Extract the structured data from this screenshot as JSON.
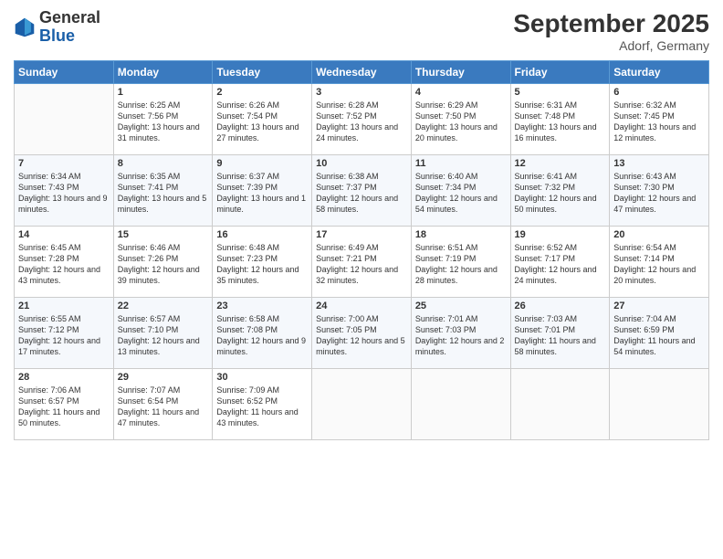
{
  "header": {
    "logo_general": "General",
    "logo_blue": "Blue",
    "month_title": "September 2025",
    "location": "Adorf, Germany"
  },
  "weekdays": [
    "Sunday",
    "Monday",
    "Tuesday",
    "Wednesday",
    "Thursday",
    "Friday",
    "Saturday"
  ],
  "weeks": [
    [
      {
        "day": "",
        "sunrise": "",
        "sunset": "",
        "daylight": ""
      },
      {
        "day": "1",
        "sunrise": "Sunrise: 6:25 AM",
        "sunset": "Sunset: 7:56 PM",
        "daylight": "Daylight: 13 hours and 31 minutes."
      },
      {
        "day": "2",
        "sunrise": "Sunrise: 6:26 AM",
        "sunset": "Sunset: 7:54 PM",
        "daylight": "Daylight: 13 hours and 27 minutes."
      },
      {
        "day": "3",
        "sunrise": "Sunrise: 6:28 AM",
        "sunset": "Sunset: 7:52 PM",
        "daylight": "Daylight: 13 hours and 24 minutes."
      },
      {
        "day": "4",
        "sunrise": "Sunrise: 6:29 AM",
        "sunset": "Sunset: 7:50 PM",
        "daylight": "Daylight: 13 hours and 20 minutes."
      },
      {
        "day": "5",
        "sunrise": "Sunrise: 6:31 AM",
        "sunset": "Sunset: 7:48 PM",
        "daylight": "Daylight: 13 hours and 16 minutes."
      },
      {
        "day": "6",
        "sunrise": "Sunrise: 6:32 AM",
        "sunset": "Sunset: 7:45 PM",
        "daylight": "Daylight: 13 hours and 12 minutes."
      }
    ],
    [
      {
        "day": "7",
        "sunrise": "Sunrise: 6:34 AM",
        "sunset": "Sunset: 7:43 PM",
        "daylight": "Daylight: 13 hours and 9 minutes."
      },
      {
        "day": "8",
        "sunrise": "Sunrise: 6:35 AM",
        "sunset": "Sunset: 7:41 PM",
        "daylight": "Daylight: 13 hours and 5 minutes."
      },
      {
        "day": "9",
        "sunrise": "Sunrise: 6:37 AM",
        "sunset": "Sunset: 7:39 PM",
        "daylight": "Daylight: 13 hours and 1 minute."
      },
      {
        "day": "10",
        "sunrise": "Sunrise: 6:38 AM",
        "sunset": "Sunset: 7:37 PM",
        "daylight": "Daylight: 12 hours and 58 minutes."
      },
      {
        "day": "11",
        "sunrise": "Sunrise: 6:40 AM",
        "sunset": "Sunset: 7:34 PM",
        "daylight": "Daylight: 12 hours and 54 minutes."
      },
      {
        "day": "12",
        "sunrise": "Sunrise: 6:41 AM",
        "sunset": "Sunset: 7:32 PM",
        "daylight": "Daylight: 12 hours and 50 minutes."
      },
      {
        "day": "13",
        "sunrise": "Sunrise: 6:43 AM",
        "sunset": "Sunset: 7:30 PM",
        "daylight": "Daylight: 12 hours and 47 minutes."
      }
    ],
    [
      {
        "day": "14",
        "sunrise": "Sunrise: 6:45 AM",
        "sunset": "Sunset: 7:28 PM",
        "daylight": "Daylight: 12 hours and 43 minutes."
      },
      {
        "day": "15",
        "sunrise": "Sunrise: 6:46 AM",
        "sunset": "Sunset: 7:26 PM",
        "daylight": "Daylight: 12 hours and 39 minutes."
      },
      {
        "day": "16",
        "sunrise": "Sunrise: 6:48 AM",
        "sunset": "Sunset: 7:23 PM",
        "daylight": "Daylight: 12 hours and 35 minutes."
      },
      {
        "day": "17",
        "sunrise": "Sunrise: 6:49 AM",
        "sunset": "Sunset: 7:21 PM",
        "daylight": "Daylight: 12 hours and 32 minutes."
      },
      {
        "day": "18",
        "sunrise": "Sunrise: 6:51 AM",
        "sunset": "Sunset: 7:19 PM",
        "daylight": "Daylight: 12 hours and 28 minutes."
      },
      {
        "day": "19",
        "sunrise": "Sunrise: 6:52 AM",
        "sunset": "Sunset: 7:17 PM",
        "daylight": "Daylight: 12 hours and 24 minutes."
      },
      {
        "day": "20",
        "sunrise": "Sunrise: 6:54 AM",
        "sunset": "Sunset: 7:14 PM",
        "daylight": "Daylight: 12 hours and 20 minutes."
      }
    ],
    [
      {
        "day": "21",
        "sunrise": "Sunrise: 6:55 AM",
        "sunset": "Sunset: 7:12 PM",
        "daylight": "Daylight: 12 hours and 17 minutes."
      },
      {
        "day": "22",
        "sunrise": "Sunrise: 6:57 AM",
        "sunset": "Sunset: 7:10 PM",
        "daylight": "Daylight: 12 hours and 13 minutes."
      },
      {
        "day": "23",
        "sunrise": "Sunrise: 6:58 AM",
        "sunset": "Sunset: 7:08 PM",
        "daylight": "Daylight: 12 hours and 9 minutes."
      },
      {
        "day": "24",
        "sunrise": "Sunrise: 7:00 AM",
        "sunset": "Sunset: 7:05 PM",
        "daylight": "Daylight: 12 hours and 5 minutes."
      },
      {
        "day": "25",
        "sunrise": "Sunrise: 7:01 AM",
        "sunset": "Sunset: 7:03 PM",
        "daylight": "Daylight: 12 hours and 2 minutes."
      },
      {
        "day": "26",
        "sunrise": "Sunrise: 7:03 AM",
        "sunset": "Sunset: 7:01 PM",
        "daylight": "Daylight: 11 hours and 58 minutes."
      },
      {
        "day": "27",
        "sunrise": "Sunrise: 7:04 AM",
        "sunset": "Sunset: 6:59 PM",
        "daylight": "Daylight: 11 hours and 54 minutes."
      }
    ],
    [
      {
        "day": "28",
        "sunrise": "Sunrise: 7:06 AM",
        "sunset": "Sunset: 6:57 PM",
        "daylight": "Daylight: 11 hours and 50 minutes."
      },
      {
        "day": "29",
        "sunrise": "Sunrise: 7:07 AM",
        "sunset": "Sunset: 6:54 PM",
        "daylight": "Daylight: 11 hours and 47 minutes."
      },
      {
        "day": "30",
        "sunrise": "Sunrise: 7:09 AM",
        "sunset": "Sunset: 6:52 PM",
        "daylight": "Daylight: 11 hours and 43 minutes."
      },
      {
        "day": "",
        "sunrise": "",
        "sunset": "",
        "daylight": ""
      },
      {
        "day": "",
        "sunrise": "",
        "sunset": "",
        "daylight": ""
      },
      {
        "day": "",
        "sunrise": "",
        "sunset": "",
        "daylight": ""
      },
      {
        "day": "",
        "sunrise": "",
        "sunset": "",
        "daylight": ""
      }
    ]
  ]
}
